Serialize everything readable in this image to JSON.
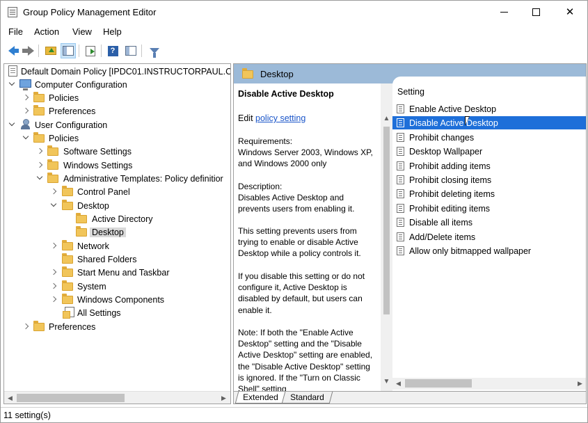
{
  "window": {
    "title": "Group Policy Management Editor"
  },
  "menu": [
    "File",
    "Action",
    "View",
    "Help"
  ],
  "toolbar": {
    "icons": [
      "back-arrow-icon",
      "forward-arrow-icon",
      "up-folder-icon",
      "show-hide-tree-icon",
      "export-list-icon",
      "help-icon",
      "properties-icon",
      "filter-icon"
    ]
  },
  "tree": {
    "root": "Default Domain Policy [IPDC01.INSTRUCTORPAUL.CO",
    "computer_config": "Computer Configuration",
    "cc_policies": "Policies",
    "cc_preferences": "Preferences",
    "user_config": "User Configuration",
    "uc_policies": "Policies",
    "software_settings": "Software Settings",
    "windows_settings": "Windows Settings",
    "admin_templates": "Administrative Templates: Policy definitior",
    "control_panel": "Control Panel",
    "desktop": "Desktop",
    "active_directory": "Active Directory",
    "desktop_child": "Desktop",
    "network": "Network",
    "shared_folders": "Shared Folders",
    "start_menu": "Start Menu and Taskbar",
    "system": "System",
    "windows_components": "Windows Components",
    "all_settings": "All Settings",
    "uc_preferences": "Preferences"
  },
  "right": {
    "header": "Desktop",
    "desc_title": "Disable Active Desktop",
    "edit_prefix": "Edit ",
    "edit_link": "policy setting",
    "requirements_label": "Requirements:",
    "requirements_text": "Windows Server 2003, Windows XP, and Windows 2000 only",
    "description_label": "Description:",
    "description_text": "Disables Active Desktop and prevents users from enabling it.",
    "para1": "This setting prevents users from trying to enable or disable Active Desktop while a policy controls it.",
    "para2": "If you disable this setting or do not configure it, Active Desktop is disabled by default, but users can enable it.",
    "para3": "Note: If both the \"Enable Active Desktop\" setting and the \"Disable Active Desktop\" setting are enabled, the \"Disable Active Desktop\" setting is ignored. If the \"Turn on Classic Shell\" setting",
    "list_header": "Setting",
    "settings": [
      "Enable Active Desktop",
      "Disable Active Desktop",
      "Prohibit changes",
      "Desktop Wallpaper",
      "Prohibit adding items",
      "Prohibit closing items",
      "Prohibit deleting items",
      "Prohibit editing items",
      "Disable all items",
      "Add/Delete items",
      "Allow only bitmapped wallpaper"
    ],
    "selected_index": 1,
    "tabs": [
      "Extended",
      "Standard"
    ]
  },
  "status": "11 setting(s)",
  "colors": {
    "selection": "#1e6fd9",
    "header_bg": "#9cbad8",
    "link": "#1a55c9"
  }
}
